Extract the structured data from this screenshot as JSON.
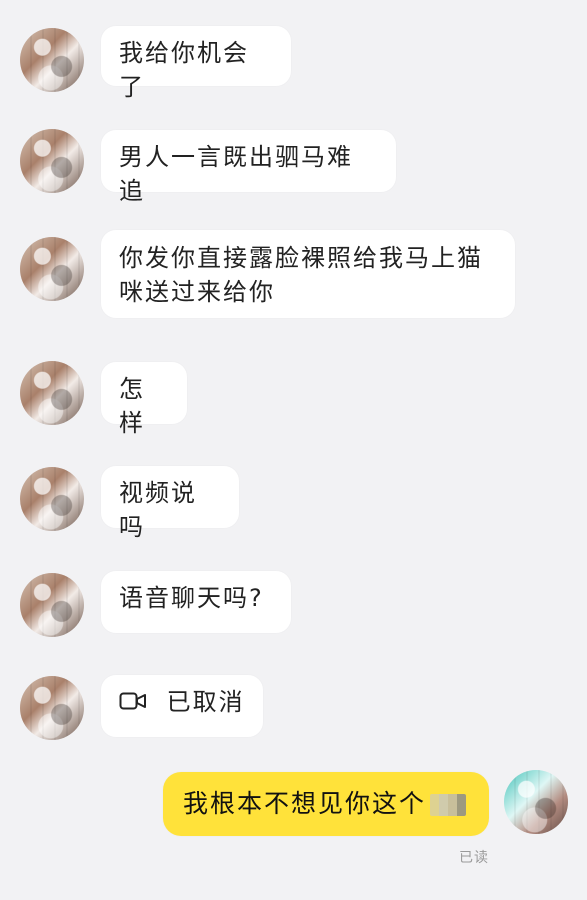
{
  "chat": {
    "messages": [
      {
        "id": "m1",
        "side": "left",
        "text": "我给你机会了"
      },
      {
        "id": "m2",
        "side": "left",
        "text": "男人一言既出驷马难追"
      },
      {
        "id": "m3",
        "side": "left",
        "text": "你发你直接露脸裸照给我马上猫咪送过来给你"
      },
      {
        "id": "m4",
        "side": "left",
        "text": "怎样"
      },
      {
        "id": "m5",
        "side": "left",
        "text": "视频说吗"
      },
      {
        "id": "m6",
        "side": "left",
        "text": "语音聊天吗?"
      },
      {
        "id": "m7",
        "side": "left",
        "text": "已取消",
        "icon": "video-camera-icon"
      },
      {
        "id": "m8",
        "side": "right",
        "text": "我根本不想见你这个"
      }
    ],
    "status": {
      "read_text": "已读"
    }
  },
  "colors": {
    "background": "#f2f2f4",
    "incoming_bubble": "#ffffff",
    "outgoing_bubble": "#ffe23a",
    "text": "#222222",
    "status_text": "#9a9a9a"
  }
}
